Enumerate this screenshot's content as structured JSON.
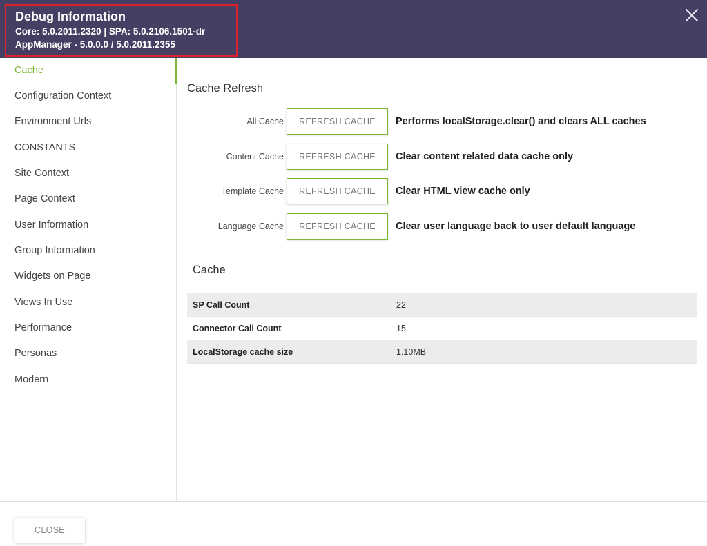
{
  "header": {
    "title": "Debug Information",
    "versions_line": "Core: 5.0.2011.2320 | SPA: 5.0.2106.1501-dr",
    "appmanager_line": "AppManager - 5.0.0.0 / 5.0.2011.2355",
    "close_icon": "close-icon",
    "background_color": "#463f64",
    "highlight_color": "#e0202a"
  },
  "sidebar": {
    "accent_color": "#7cb82f",
    "items": [
      {
        "label": "Cache",
        "active": true
      },
      {
        "label": "Configuration Context"
      },
      {
        "label": "Environment Urls"
      },
      {
        "label": "CONSTANTS"
      },
      {
        "label": "Site Context"
      },
      {
        "label": "Page Context"
      },
      {
        "label": "User Information"
      },
      {
        "label": "Group Information"
      },
      {
        "label": "Widgets on Page"
      },
      {
        "label": "Views In Use"
      },
      {
        "label": "Performance"
      },
      {
        "label": "Personas"
      },
      {
        "label": "Modern"
      }
    ]
  },
  "main": {
    "refresh_heading": "Cache Refresh",
    "refresh_rows": [
      {
        "label": "All Cache",
        "button": "REFRESH CACHE",
        "description": "Performs localStorage.clear() and clears ALL caches"
      },
      {
        "label": "Content Cache",
        "button": "REFRESH CACHE",
        "description": "Clear content related data cache only"
      },
      {
        "label": "Template Cache",
        "button": "REFRESH CACHE",
        "description": "Clear HTML view cache only"
      },
      {
        "label": "Language Cache",
        "button": "REFRESH CACHE",
        "description": "Clear user language back to user default language"
      }
    ],
    "cache_heading": "Cache",
    "stats": [
      {
        "key": "SP Call Count",
        "value": "22"
      },
      {
        "key": "Connector Call Count",
        "value": "15"
      },
      {
        "key": "LocalStorage cache size",
        "value": "1.10MB"
      }
    ]
  },
  "footer": {
    "close_label": "CLOSE"
  }
}
